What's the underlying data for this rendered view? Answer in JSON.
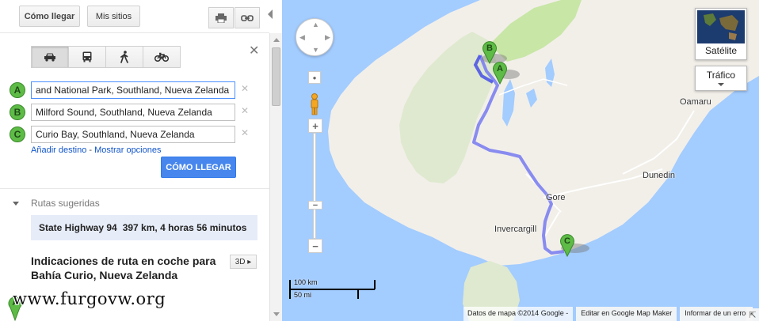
{
  "toolbar": {
    "directions_label": "Cómo llegar",
    "my_places_label": "Mis sitios",
    "print_icon": "printer-icon",
    "link_icon": "link-icon"
  },
  "travel_modes": [
    {
      "name": "car-icon",
      "active": true
    },
    {
      "name": "bus-icon",
      "active": false
    },
    {
      "name": "walk-icon",
      "active": false
    },
    {
      "name": "bike-icon",
      "active": false
    }
  ],
  "waypoints": [
    {
      "marker": "A",
      "value": "and National Park, Southland, Nueva Zelanda"
    },
    {
      "marker": "B",
      "value": "Milford Sound, Southland, Nueva Zelanda"
    },
    {
      "marker": "C",
      "value": "Curio Bay, Southland, Nueva Zelanda"
    }
  ],
  "links": {
    "add_destination": "Añadir destino",
    "separator": " - ",
    "show_options": "Mostrar opciones"
  },
  "go_button": "CÓMO LLEGAR",
  "suggested": {
    "header": "Rutas sugeridas",
    "route_name": "State Highway 94",
    "distance": "397 km,",
    "duration": "4 horas 56 minutos"
  },
  "directions": {
    "title": "Indicaciones de ruta en coche para Bahía Curio, Nueva Zelanda",
    "button_3d": "3D",
    "start_marker": "A"
  },
  "watermark": "www.furgovw.org",
  "map": {
    "places": [
      {
        "label": "Oamaru"
      },
      {
        "label": "Dunedin"
      },
      {
        "label": "Gore"
      },
      {
        "label": "Invercargill"
      }
    ],
    "markers": [
      "A",
      "B",
      "C"
    ],
    "satellite_label": "Satélite",
    "traffic_label": "Tráfico",
    "scale_km": "100 km",
    "scale_mi": "50 mi",
    "footer_data": "Datos de mapa ©2014 Google -",
    "footer_edit": "Editar en Google Map Maker",
    "footer_report": "Informar de un error",
    "colors": {
      "water": "#a3ccff",
      "land": "#f2efe9",
      "park": "#c8e6a6",
      "route": "#7c80f0",
      "marker": "#5dbb46"
    }
  }
}
